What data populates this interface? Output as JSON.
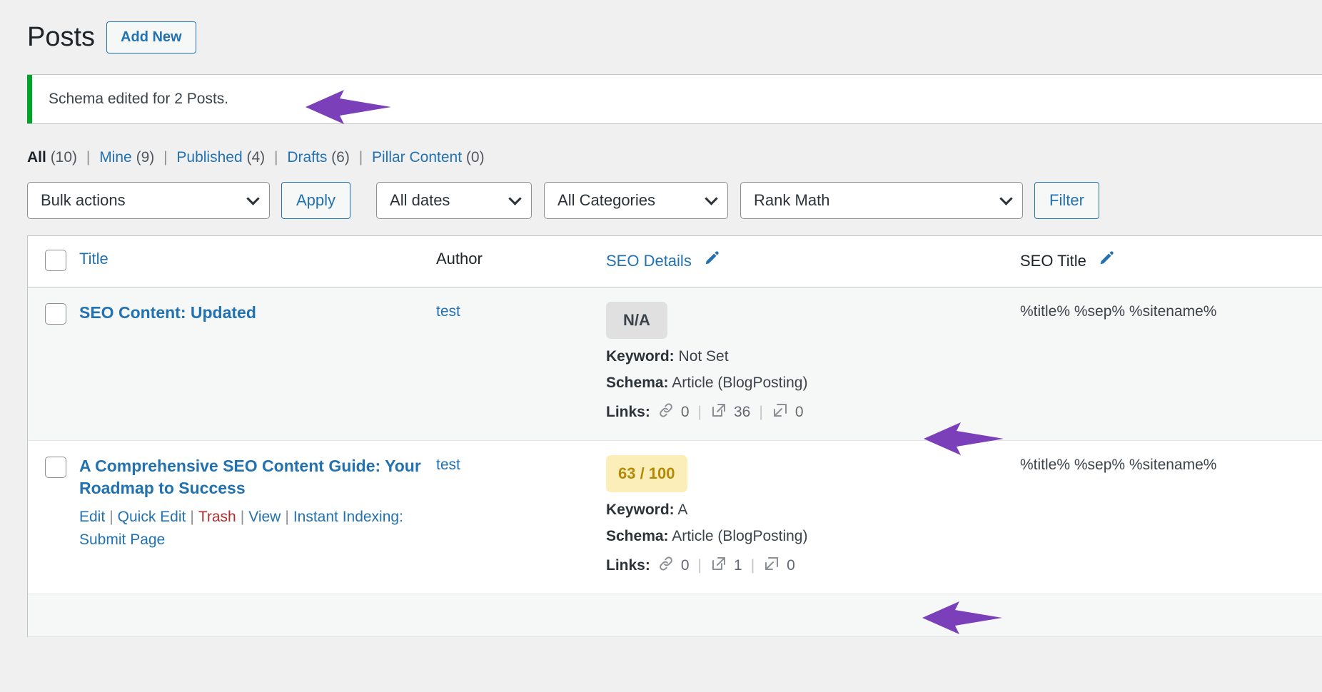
{
  "header": {
    "title": "Posts",
    "add_new_label": "Add New"
  },
  "notice": {
    "message": "Schema edited for 2 Posts.",
    "accent_color": "#00a32a"
  },
  "filter_links": [
    {
      "label": "All",
      "count": "(10)",
      "current": true
    },
    {
      "label": "Mine",
      "count": "(9)",
      "current": false
    },
    {
      "label": "Published",
      "count": "(4)",
      "current": false
    },
    {
      "label": "Drafts",
      "count": "(6)",
      "current": false
    },
    {
      "label": "Pillar Content",
      "count": "(0)",
      "current": false
    }
  ],
  "toolbar": {
    "bulk_actions_value": "Bulk actions",
    "apply_label": "Apply",
    "all_dates_value": "All dates",
    "all_categories_value": "All Categories",
    "rank_math_value": "Rank Math",
    "filter_label": "Filter"
  },
  "table": {
    "columns": {
      "title": "Title",
      "author": "Author",
      "seo_details": "SEO Details",
      "seo_title": "SEO Title"
    },
    "rows": [
      {
        "title": "SEO Content: Updated",
        "author": "test",
        "score": "N/A",
        "score_type": "na",
        "keyword_label": "Keyword:",
        "keyword_value": "Not Set",
        "schema_label": "Schema:",
        "schema_value": "Article (BlogPosting)",
        "links_label": "Links:",
        "links_internal": "0",
        "links_external": "36",
        "links_outgoing": "0",
        "seo_title": "%title% %sep% %sitename%",
        "row_actions": []
      },
      {
        "title": "A Comprehensive SEO Content Guide: Your Roadmap to Success",
        "author": "test",
        "score": "63 / 100",
        "score_type": "ok",
        "keyword_label": "Keyword:",
        "keyword_value": "A",
        "schema_label": "Schema:",
        "schema_value": "Article (BlogPosting)",
        "links_label": "Links:",
        "links_internal": "0",
        "links_external": "1",
        "links_outgoing": "0",
        "seo_title": "%title% %sep% %sitename%",
        "row_actions": [
          {
            "label": "Edit",
            "style": "normal"
          },
          {
            "label": "Quick Edit",
            "style": "normal"
          },
          {
            "label": "Trash",
            "style": "trash"
          },
          {
            "label": "View",
            "style": "normal"
          },
          {
            "label": "Instant Indexing: Submit Page",
            "style": "normal"
          }
        ]
      }
    ]
  },
  "annotations": {
    "arrow_color": "#7b3fba",
    "arrows": [
      {
        "target": "notice-message"
      },
      {
        "target": "row-0-schema"
      },
      {
        "target": "row-1-schema"
      }
    ]
  }
}
